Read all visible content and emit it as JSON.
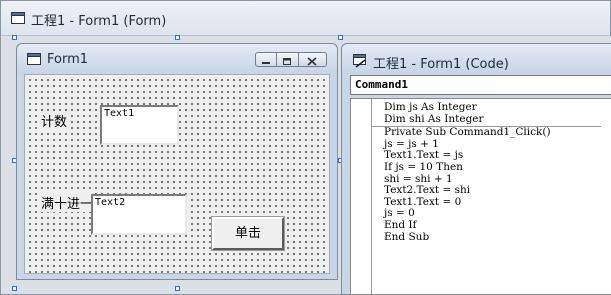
{
  "outer_window": {
    "title": "工程1 - Form1 (Form)",
    "icon": "form-window-icon"
  },
  "form1": {
    "title": "Form1",
    "caption_buttons": [
      "minimize",
      "maximize",
      "close"
    ],
    "label_count": "计数",
    "label_carry": "满十进一",
    "text1_value": "Text1",
    "text2_value": "Text2",
    "command_button_label": "单击"
  },
  "code_window": {
    "title": "工程1 - Form1 (Code)",
    "object_combo_value": "Command1",
    "declarations": [
      "Dim js As Integer",
      "Dim shi As Integer"
    ],
    "lines": [
      "Private Sub Command1_Click()",
      "js = js + 1",
      "Text1.Text = js",
      "If js = 10 Then",
      "shi = shi + 1",
      "Text2.Text = shi",
      "Text1.Text = 0",
      "js = 0",
      "End If",
      "End Sub"
    ]
  }
}
